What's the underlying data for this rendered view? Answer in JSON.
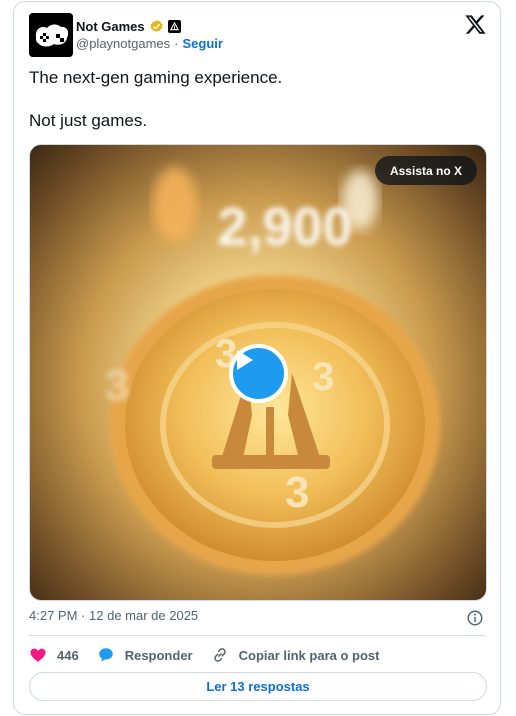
{
  "author": {
    "display_name": "Not Games",
    "handle": "@playnotgames",
    "separator": "·",
    "follow_label": "Seguir"
  },
  "tweet": {
    "lines": [
      "The next-gen gaming experience.",
      "Not just games."
    ]
  },
  "media": {
    "watch_label": "Assista no X",
    "score_text": "2,900",
    "coin_digit": "3"
  },
  "meta": {
    "time": "4:27 PM",
    "separator": "·",
    "date": "12 de mar de 2025"
  },
  "actions": {
    "likes": "446",
    "reply_label": "Responder",
    "copy_label": "Copiar link para o post"
  },
  "replies_button": "Ler 13 respostas",
  "colors": {
    "accent_blue": "#1d9bf0",
    "link_blue": "#0f6fd1",
    "like_pink": "#f91880",
    "verified_gold": "#e2b719",
    "gray_text": "#536471",
    "border": "#cfd9de"
  }
}
